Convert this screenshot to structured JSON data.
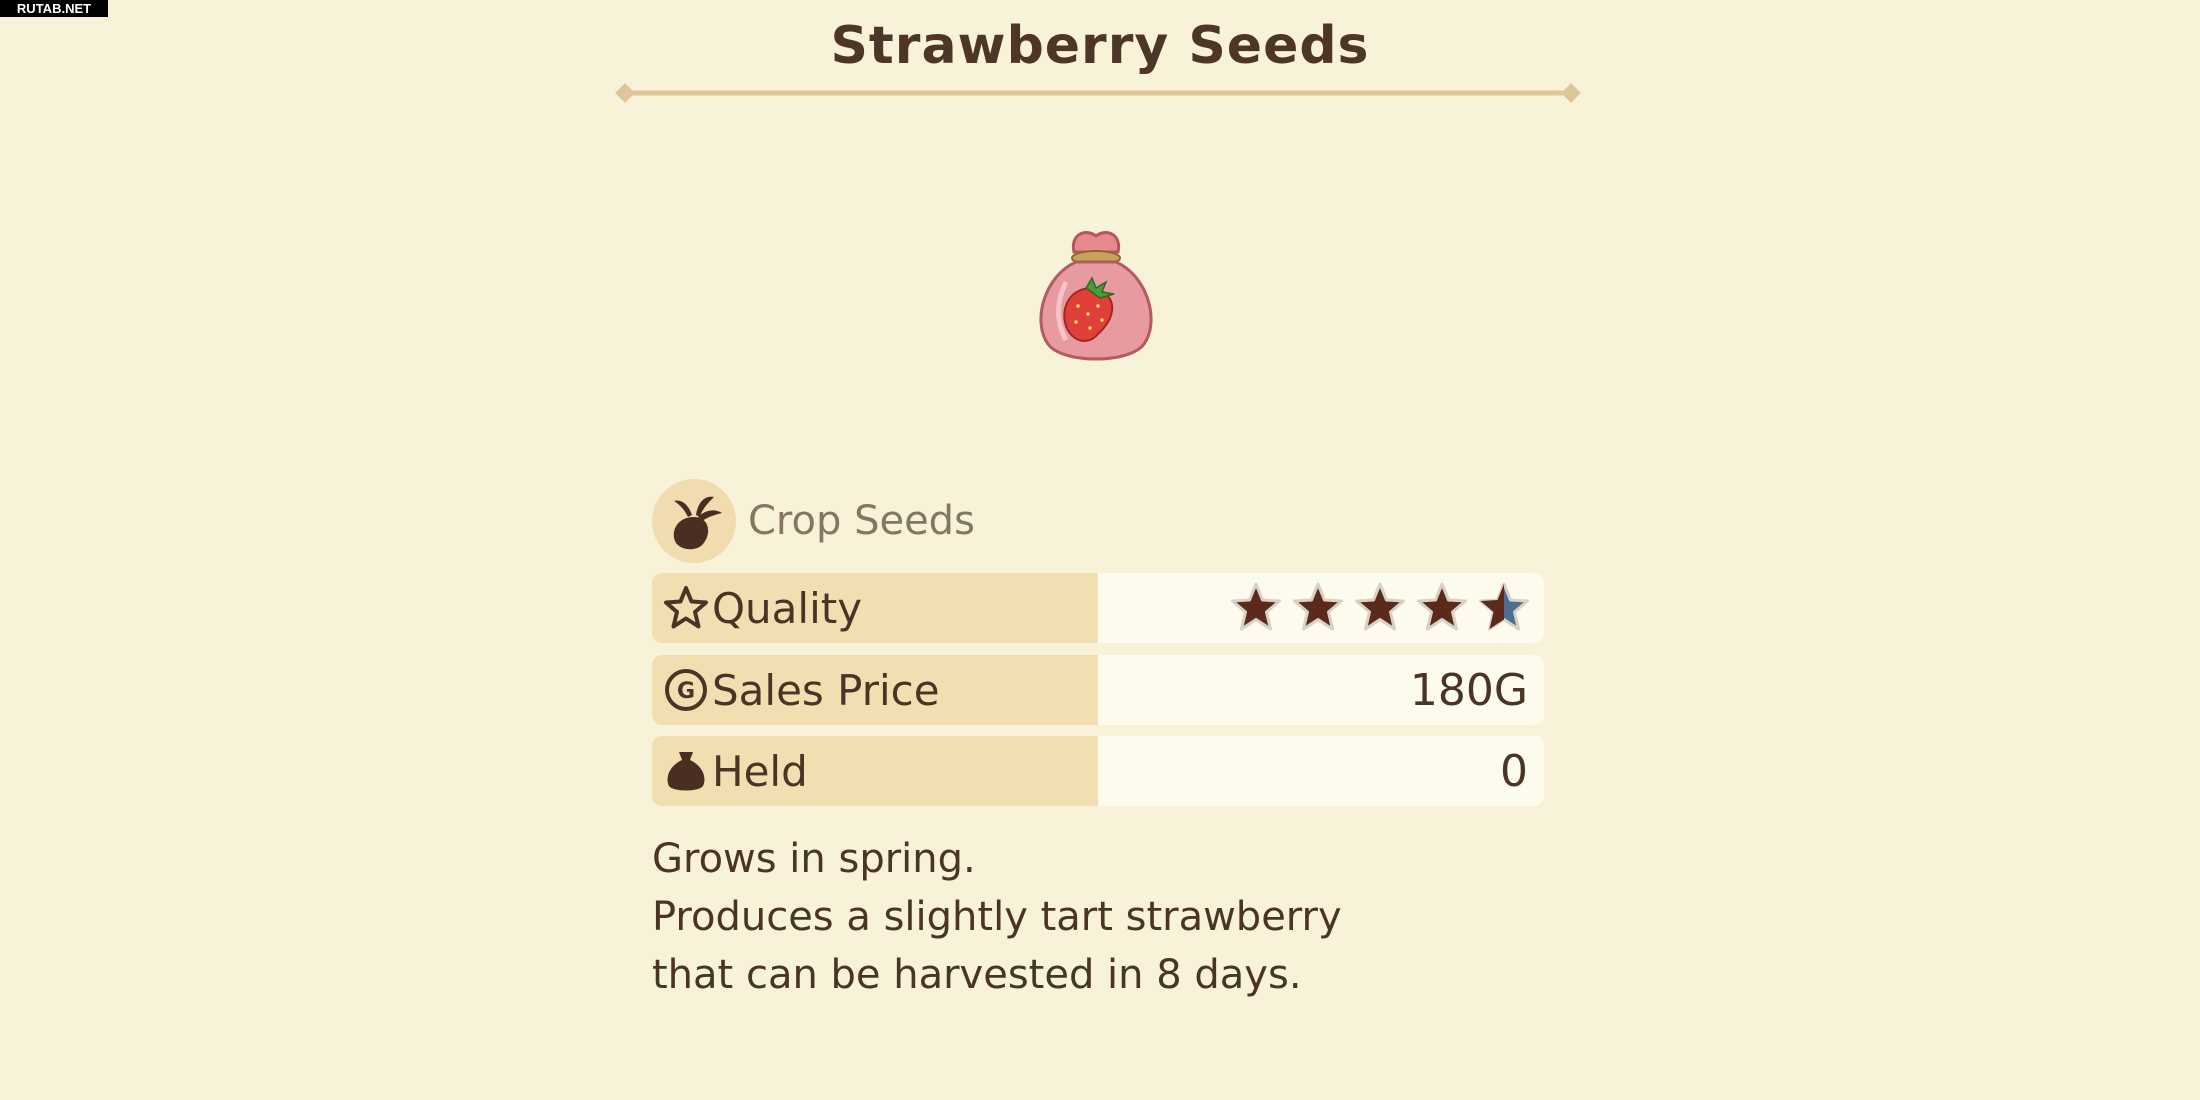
{
  "watermark": "RUTAB.NET",
  "item": {
    "name": "Strawberry Seeds",
    "icon": "strawberry-seed-bag-icon"
  },
  "category": {
    "icon": "turnip-icon",
    "label": "Crop Seeds"
  },
  "stats": {
    "quality": {
      "icon": "star-outline-icon",
      "label": "Quality",
      "stars": 4.5,
      "max_stars": 5
    },
    "sales_price": {
      "icon": "gold-coin-icon",
      "label": "Sales Price",
      "value": "180G"
    },
    "held": {
      "icon": "pouch-icon",
      "label": "Held",
      "value": "0"
    }
  },
  "description": {
    "lines": [
      "Grows in spring.",
      "Produces a slightly tart strawberry",
      "that can be harvested in 8 days."
    ]
  },
  "colors": {
    "background": "#f8f3d8",
    "text": "#4a3426",
    "label_cell": "#f1dfb2",
    "value_cell": "#fdfbee",
    "star_fill": "#5a2a1c",
    "star_half": "#4d6f8f"
  }
}
